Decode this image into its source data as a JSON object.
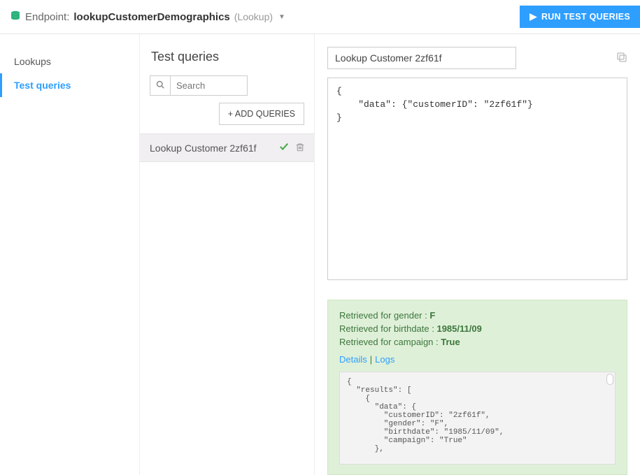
{
  "header": {
    "endpoint_label": "Endpoint:",
    "endpoint_name": "lookupCustomerDemographics",
    "endpoint_type": "(Lookup)",
    "run_button": "RUN TEST QUERIES"
  },
  "sidebar": {
    "items": [
      {
        "label": "Lookups",
        "active": false
      },
      {
        "label": "Test queries",
        "active": true
      }
    ]
  },
  "queries_panel": {
    "title": "Test queries",
    "search_placeholder": "Search",
    "add_button": "+ ADD QUERIES",
    "items": [
      {
        "label": "Lookup Customer 2zf61f",
        "status": "ok"
      }
    ]
  },
  "detail": {
    "name_value": "Lookup Customer 2zf61f",
    "code": "{\n    \"data\": {\"customerID\": \"2zf61f\"}\n}"
  },
  "results": {
    "lines": [
      {
        "prefix": "Retrieved for gender : ",
        "value": "F"
      },
      {
        "prefix": "Retrieved for birthdate : ",
        "value": "1985/11/09"
      },
      {
        "prefix": "Retrieved for campaign : ",
        "value": "True"
      }
    ],
    "details_link": "Details",
    "logs_link": "Logs",
    "json": "{\n  \"results\": [\n    {\n      \"data\": {\n        \"customerID\": \"2zf61f\",\n        \"gender\": \"F\",\n        \"birthdate\": \"1985/11/09\",\n        \"campaign\": \"True\"\n      },"
  }
}
